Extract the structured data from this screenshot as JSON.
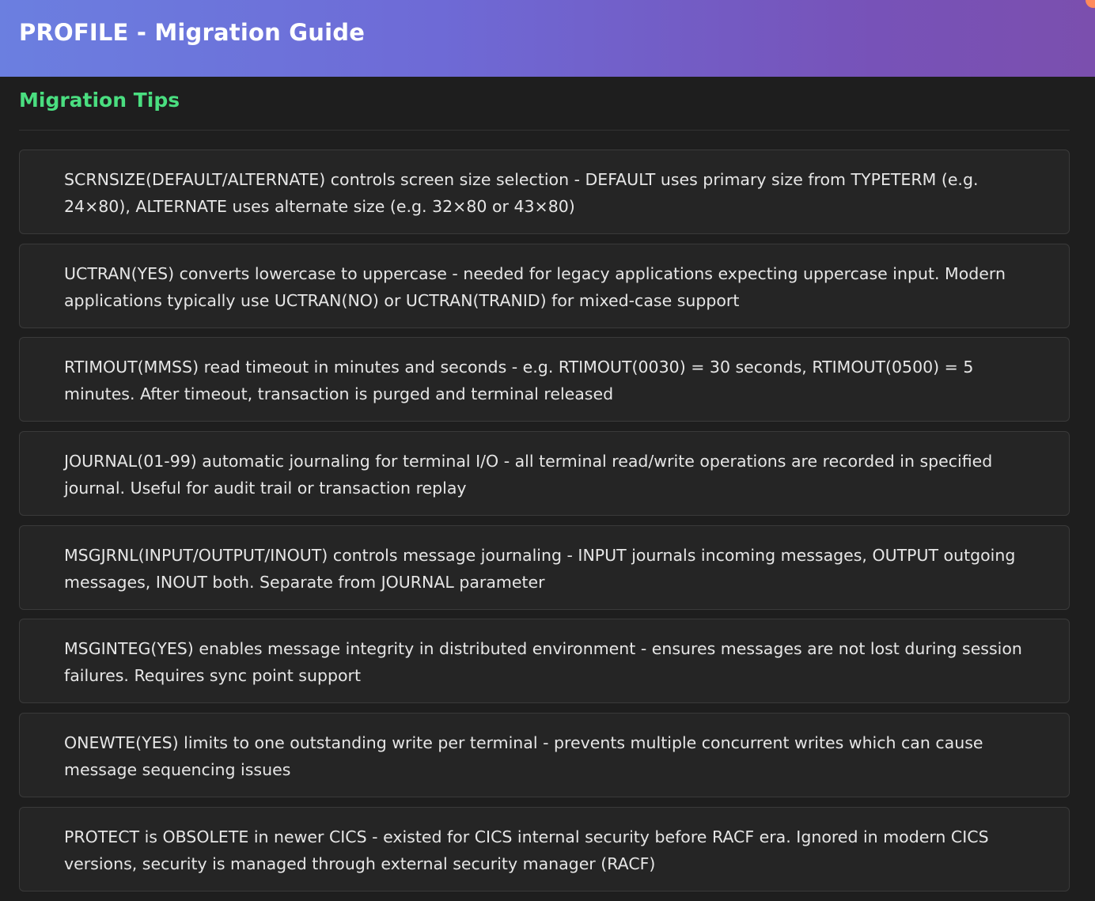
{
  "header": {
    "title": "PROFILE - Migration Guide"
  },
  "section": {
    "title": "Migration Tips"
  },
  "tips": [
    "SCRNSIZE(DEFAULT/ALTERNATE) controls screen size selection - DEFAULT uses primary size from TYPETERM (e.g. 24×80), ALTERNATE uses alternate size (e.g. 32×80 or 43×80)",
    "UCTRAN(YES) converts lowercase to uppercase - needed for legacy applications expecting uppercase input. Modern applications typically use UCTRAN(NO) or UCTRAN(TRANID) for mixed-case support",
    "RTIMOUT(MMSS) read timeout in minutes and seconds - e.g. RTIMOUT(0030) = 30 seconds, RTIMOUT(0500) = 5 minutes. After timeout, transaction is purged and terminal released",
    "JOURNAL(01-99) automatic journaling for terminal I/O - all terminal read/write operations are recorded in specified journal. Useful for audit trail or transaction replay",
    "MSGJRNL(INPUT/OUTPUT/INOUT) controls message journaling - INPUT journals incoming messages, OUTPUT outgoing messages, INOUT both. Separate from JOURNAL parameter",
    "MSGINTEG(YES) enables message integrity in distributed environment - ensures messages are not lost during session failures. Requires sync point support",
    "ONEWTE(YES) limits to one outstanding write per terminal - prevents multiple concurrent writes which can cause message sequencing issues",
    "PROTECT is OBSOLETE in newer CICS - existed for CICS internal security before RACF era. Ignored in modern CICS versions, security is managed through external security manager (RACF)"
  ]
}
